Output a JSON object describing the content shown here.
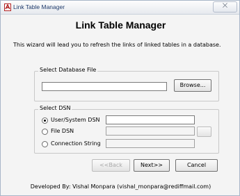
{
  "window": {
    "title": "Link Table Manager",
    "close_label": "⨉"
  },
  "heading": "Link Table Manager",
  "intro": "This wizard will lead you to refresh the links of linked tables in a database.",
  "database_group": {
    "label": "Select Database File",
    "file_value": "",
    "browse_label": "Browse..."
  },
  "dsn_group": {
    "label": "Select DSN",
    "options": [
      {
        "label": "User/System DSN",
        "selected": true,
        "value": ""
      },
      {
        "label": "File DSN",
        "selected": false,
        "value": ""
      },
      {
        "label": "Connection String",
        "selected": false,
        "value": ""
      }
    ]
  },
  "buttons": {
    "back_label": "<<Back",
    "next_label": "Next>>",
    "cancel_label": "Cancel"
  },
  "footer": "Developed By: Vishal Monpara (vishal_monpara@rediffmail.com)"
}
